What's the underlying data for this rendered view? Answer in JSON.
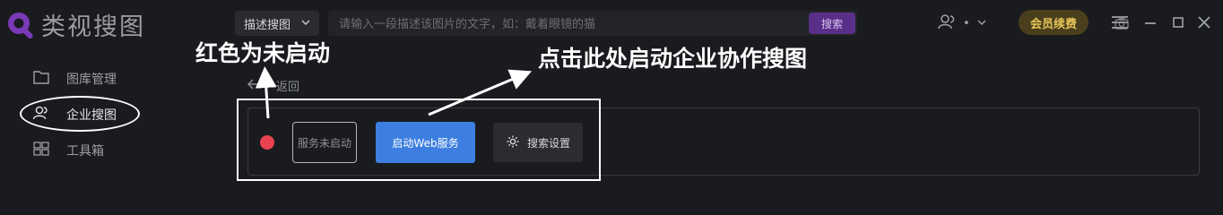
{
  "app": {
    "title": "类视搜图"
  },
  "toolbar": {
    "mode_select": "描述搜图",
    "search_placeholder": "请输入一段描述该图片的文字，如：戴着眼镜的猫",
    "search_button": "搜索",
    "user_label": "•",
    "member_button": "会员续费"
  },
  "sidebar": {
    "items": [
      {
        "label": "图库管理",
        "icon": "folder-icon"
      },
      {
        "label": "企业搜图",
        "icon": "team-icon"
      },
      {
        "label": "工具箱",
        "icon": "toolbox-icon"
      }
    ],
    "active_index": 1
  },
  "content": {
    "back_label": "返回",
    "status_text": "服务未启动",
    "status_color": "#e8434f",
    "start_button": "启动Web服务",
    "settings_button": "搜索设置"
  },
  "annotations": {
    "status_note": "红色为未启动",
    "start_note": "点击此处启动企业协作搜图"
  },
  "colors": {
    "background": "#1a1b1f",
    "accent_purple": "#5a2f8a",
    "primary_blue": "#3d7fe0",
    "member_gold": "#e7c55a",
    "annotation": "#ffffff"
  }
}
